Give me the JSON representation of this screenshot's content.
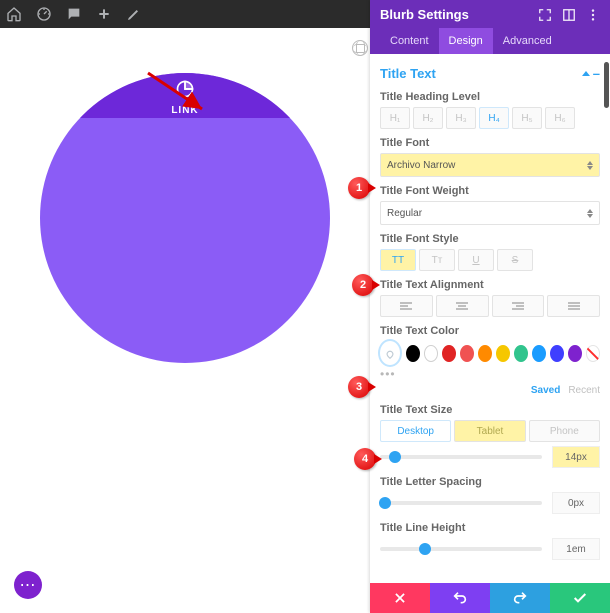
{
  "topbar": {
    "icons": [
      "home-icon",
      "dashboard-icon",
      "comment-icon",
      "plus-icon",
      "pencil-icon"
    ],
    "star": "✱"
  },
  "preview": {
    "link_label": "LINK",
    "fab": "⋯"
  },
  "panel": {
    "title": "Blurb Settings",
    "tabs": {
      "content": "Content",
      "design": "Design",
      "advanced": "Advanced"
    },
    "section": "Title Text",
    "heading_level": {
      "label": "Title Heading Level",
      "options": [
        "H₁",
        "H₂",
        "H₃",
        "H₄",
        "H₅",
        "H₆"
      ],
      "selected": "H₄"
    },
    "font": {
      "label": "Title Font",
      "value": "Archivo Narrow"
    },
    "weight": {
      "label": "Title Font Weight",
      "value": "Regular"
    },
    "style": {
      "label": "Title Font Style",
      "options": [
        "TT",
        "Tᴛ",
        "U",
        "S"
      ],
      "selected": "TT"
    },
    "align": {
      "label": "Title Text Alignment"
    },
    "color": {
      "label": "Title Text Color",
      "saved": "Saved",
      "recent": "Recent",
      "swatches": [
        "#000000",
        "#ffffff",
        "#e02424",
        "#f05252",
        "#ff8a00",
        "#f6c700",
        "#31c48d",
        "#1a9cff",
        "#3f3fff",
        "#7e22ce"
      ]
    },
    "size": {
      "label": "Title Text Size",
      "devices": {
        "desktop": "Desktop",
        "tablet": "Tablet",
        "phone": "Phone"
      },
      "value": "14px",
      "percent": 9
    },
    "letter": {
      "label": "Title Letter Spacing",
      "value": "0px",
      "percent": 3
    },
    "lineh": {
      "label": "Title Line Height",
      "value": "1em",
      "percent": 28
    }
  },
  "callouts": {
    "c1": "1",
    "c2": "2",
    "c3": "3",
    "c4": "4"
  }
}
